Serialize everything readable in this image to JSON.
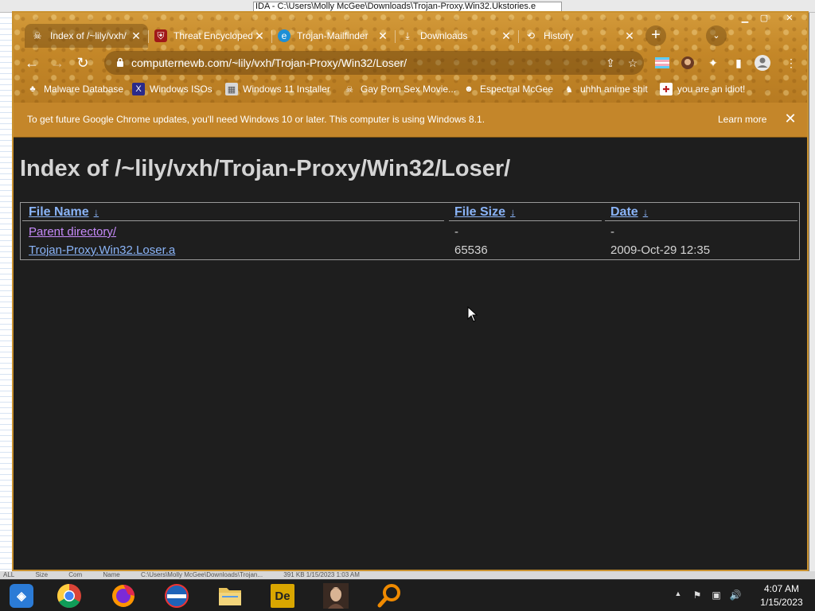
{
  "background": {
    "window_title": "IDA - C:\\Users\\Molly McGee\\Downloads\\Trojan-Proxy.Win32.Ukstories.e",
    "bottom_strip": [
      "ALL",
      "Size",
      "Com",
      "Name",
      "C:\\Users\\Molly McGee\\Downloads\\Trojan...",
      "391 KB  1/15/2023 1:03 AM"
    ]
  },
  "browser": {
    "tabs": [
      {
        "title": "Index of /~lily/vxh/",
        "favicon": "☠",
        "active": true
      },
      {
        "title": "Threat Encyclopedia",
        "favicon": "⛨",
        "active": false
      },
      {
        "title": "Trojan-Mailfinder",
        "favicon": "e",
        "active": false
      },
      {
        "title": "Downloads",
        "favicon": "⤓",
        "active": false
      },
      {
        "title": "History",
        "favicon": "⟲",
        "active": false
      }
    ],
    "new_tab_label": "+",
    "tab_search_label": "⌄",
    "window_controls": {
      "minimize": "▁",
      "maximize": "▢",
      "close": "✕"
    },
    "nav": {
      "back": "←",
      "forward": "→",
      "reload": "↻"
    },
    "url": "computernewb.com/~lily/vxh/Trojan-Proxy/Win32/Loser/",
    "omnibox_icons": {
      "share": "⇪",
      "star": "☆"
    },
    "toolbar_icons": {
      "extension_flag": "≡",
      "avatar_ext": "●",
      "puzzle": "✦",
      "sidebar": "▮",
      "profile": "◉",
      "menu": "⋮"
    },
    "bookmarks": [
      {
        "label": "Malware Database",
        "icon": "♣",
        "icon_color": "#7a4f12"
      },
      {
        "label": "Windows ISOs",
        "icon": "X",
        "icon_color": "#2a2a8a"
      },
      {
        "label": "Windows 11 Installer",
        "icon": "▦",
        "icon_color": "#cfcfcf"
      },
      {
        "label": "Gay Porn Sex Movie...",
        "icon": "☠",
        "icon_color": "#333"
      },
      {
        "label": "Espectral McGee",
        "icon": "☻",
        "icon_color": "#8a4a20"
      },
      {
        "label": "uhhh anime shit",
        "icon": "♞",
        "icon_color": "#333"
      },
      {
        "label": "you are an idiot!",
        "icon": "✚",
        "icon_color": "#b22"
      }
    ],
    "infobar": {
      "message": "To get future Google Chrome updates, you'll need Windows 10 or later. This computer is using Windows 8.1.",
      "learn_more": "Learn more",
      "close": "✕"
    }
  },
  "page": {
    "heading": "Index of /~lily/vxh/Trojan-Proxy/Win32/Loser/",
    "columns": {
      "name": "File Name",
      "size": "File Size",
      "date": "Date",
      "sort_arrow": "↓"
    },
    "rows": [
      {
        "name": "Parent directory/",
        "size": "-",
        "date": "-"
      },
      {
        "name": "Trojan-Proxy.Win32.Loser.a",
        "size": "65536",
        "date": "2009-Oct-29 12:35"
      }
    ]
  },
  "taskbar": {
    "apps": [
      {
        "name": "start",
        "glyph": "◈",
        "color": "#2b7bd6"
      },
      {
        "name": "chrome",
        "glyph": "◎",
        "color": "#db4437"
      },
      {
        "name": "firefox",
        "glyph": "◐",
        "color": "#e66000"
      },
      {
        "name": "windows-security",
        "glyph": "◉",
        "color": "#1e63b8"
      },
      {
        "name": "file-explorer",
        "glyph": "▤",
        "color": "#e8c25a"
      },
      {
        "name": "ide",
        "glyph": "De",
        "color": "#d9a600"
      },
      {
        "name": "profile-photo",
        "glyph": "☺",
        "color": "#6b4a3a"
      },
      {
        "name": "search-tool",
        "glyph": "⚲",
        "color": "#f08a00"
      }
    ],
    "tray": {
      "chevron": "▲",
      "flag": "⚑",
      "network": "▣",
      "volume": "🔊"
    },
    "time": "4:07 AM",
    "date": "1/15/2023"
  }
}
